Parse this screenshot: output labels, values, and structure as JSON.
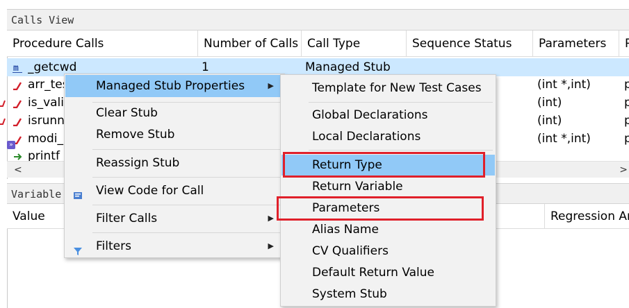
{
  "calls_view": {
    "title": "Calls View",
    "columns": [
      "Procedure Calls",
      "Number of Calls",
      "Call Type",
      "Sequence Status",
      "Parameters",
      "P"
    ],
    "rows": [
      {
        "name": "_getcwd",
        "count": "1",
        "type": "Managed Stub",
        "params": "",
        "extra": "",
        "icon": "managed-stub-icon"
      },
      {
        "name": "arr_tes",
        "count": "",
        "type": "",
        "params": "(int *,int)",
        "extra": "p",
        "icon": "stub-icon"
      },
      {
        "name": "is_vali",
        "count": "",
        "type": "",
        "params": "(int)",
        "extra": "p",
        "icon": "stub-icon"
      },
      {
        "name": "isrunn",
        "count": "",
        "type": "",
        "params": "(int)",
        "extra": "p",
        "icon": "stub-icon"
      },
      {
        "name": "modi_",
        "count": "",
        "type": "",
        "params": "(int *,int)",
        "extra": "p",
        "icon": "stub-icon"
      },
      {
        "name": "printf",
        "count": "",
        "type": "",
        "params": "",
        "extra": "",
        "icon": "arrow-icon"
      }
    ],
    "scroll_left": "<",
    "scroll_right": ">"
  },
  "variable_view": {
    "title": "Variable",
    "columns": [
      "Value",
      "Regression Ar"
    ]
  },
  "context_menu": {
    "items": [
      {
        "label": "Managed Stub Properties",
        "has_submenu": true,
        "highlighted": true
      },
      {
        "label": "Clear Stub"
      },
      {
        "label": "Remove Stub"
      },
      {
        "label": "Reassign Stub"
      },
      {
        "label": "View Code for Call",
        "icon": "code-view-icon"
      },
      {
        "label": "Filter Calls",
        "has_submenu": true
      },
      {
        "label": "Filters",
        "has_submenu": true,
        "icon": "filter-icon"
      }
    ],
    "submenu_arrow": "▶"
  },
  "submenu": {
    "items": [
      {
        "label": "Template for New Test Cases"
      },
      {
        "label": "Global Declarations"
      },
      {
        "label": "Local Declarations"
      },
      {
        "label": "Return Type",
        "highlighted": true,
        "boxed": true
      },
      {
        "label": "Return Variable"
      },
      {
        "label": "Parameters",
        "boxed": true
      },
      {
        "label": "Alias Name"
      },
      {
        "label": "CV Qualifiers"
      },
      {
        "label": "Default Return Value"
      },
      {
        "label": "System Stub"
      }
    ]
  },
  "colors": {
    "selection": "#cce8ff",
    "menu_highlight": "#91c9f7",
    "annotation_box": "#e0202a"
  }
}
